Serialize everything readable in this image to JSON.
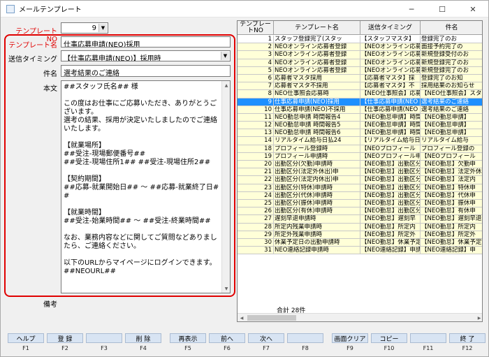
{
  "window": {
    "title": "メールテンプレート",
    "minimize": "─",
    "maximize": "☐",
    "close": "✕"
  },
  "form": {
    "template_no_label": "テンプレートNO",
    "template_no_value": "9",
    "template_name_label": "テンプレート名",
    "template_name_value": "仕事応募申請(NEO)採用",
    "timing_label": "送信タイミング",
    "timing_value": "【仕事応募申請(NEO)】採用時",
    "subject_label": "件名",
    "subject_value": "選考結果のご連絡",
    "body_label": "本文",
    "body_value": "##スタッフ氏名## 様\n\nこの度はお仕事にご応募いただき、ありがとうございます。\n選考の結果、採用が決定いたしましたのでご連絡いたします。\n\n【就業場所】\n##受注-現場郵便番号##\n##受注-現場住所1## ##受注-現場住所2##\n\n【契約期間】\n##応募-就業開始日## 〜 ##応募-就業終了日##\n\n【就業時間】\n##受注-始業時間## 〜 ##受注-終業時間##\n\nなお、業務内容などに関してご質問などありましたら、ご連絡ください。\n\n以下のURLからマイページにログインできます。\n##NEOURL##",
    "notes_label": "備考"
  },
  "grid": {
    "headers": [
      "テンプレートNO",
      "テンプレート名",
      "送信タイミング",
      "件名"
    ],
    "rows": [
      {
        "no": "1",
        "name": "スタッフ登録完了(スタッ",
        "timing": "【スタッフマスタ】",
        "subject": "登録完了のお",
        "style": "white"
      },
      {
        "no": "2",
        "name": "NEOオンライン応募者登録",
        "timing": "【NEOオンライン応募",
        "subject": "面接予約完了の",
        "style": "yellow"
      },
      {
        "no": "3",
        "name": "NEOオンライン応募者登録",
        "timing": "【NEOオンライン応募",
        "subject": "新規登録受付のお",
        "style": "yellow"
      },
      {
        "no": "4",
        "name": "NEOオンライン応募者登録",
        "timing": "【NEOオンライン応募",
        "subject": "新規登録完了のお",
        "style": "yellow"
      },
      {
        "no": "5",
        "name": "NEOオンライン応募者登録",
        "timing": "【NEOオンライン応募",
        "subject": "新規登録完了のお",
        "style": "yellow"
      },
      {
        "no": "6",
        "name": "応募者マスタ採用",
        "timing": "【応募者マスタ】採",
        "subject": "登録完了のお知",
        "style": "yellow"
      },
      {
        "no": "7",
        "name": "応募者マスタ不採用",
        "timing": "【応募者マスタ】不",
        "subject": "採用結果のお知らせ",
        "style": "yellow"
      },
      {
        "no": "8",
        "name": "NEO仕事照会応募時",
        "timing": "【NEO仕事照会】応募",
        "subject": "【NEO仕事照会】スタ",
        "style": "yellow"
      },
      {
        "no": "9",
        "name": "仕事応募申請(NEO)採用",
        "timing": "【仕事応募申請(NEO",
        "subject": "選考結果のご連絡",
        "style": "sel"
      },
      {
        "no": "10",
        "name": "仕事応募申請(NEO)不採用",
        "timing": "【仕事応募申請(NEO",
        "subject": "選考結果のご連絡",
        "style": "yellow"
      },
      {
        "no": "11",
        "name": "NEO勤怠申請 時間報告4",
        "timing": "【NEO勤怠申請】時間",
        "subject": "【NEO勤怠申請】",
        "style": "yellow"
      },
      {
        "no": "12",
        "name": "NEO勤怠申請 時間報告5",
        "timing": "【NEO勤怠申請】時間",
        "subject": "【NEO勤怠申請】",
        "style": "yellow"
      },
      {
        "no": "13",
        "name": "NEO勤怠申請 時間報告6",
        "timing": "【NEO勤怠申請】時間",
        "subject": "【NEO勤怠申請】",
        "style": "yellow"
      },
      {
        "no": "14",
        "name": "リアルタイム給与日払24",
        "timing": "【リアルタイム給与日払】",
        "subject": "リアルタイム給与",
        "style": "yellow"
      },
      {
        "no": "18",
        "name": "プロフィール登録時",
        "timing": "【NEOプロフィール",
        "subject": "プロフィール登録の",
        "style": "yellow"
      },
      {
        "no": "19",
        "name": "プロフィール申請時",
        "timing": "【NEOプロフィール申",
        "subject": "【NEOプロフィール",
        "style": "yellow"
      },
      {
        "no": "20",
        "name": "出勤区分(欠勤)申請時",
        "timing": "【NEO勤怠】出勤区分",
        "subject": "【NEO勤怠】欠勤申",
        "style": "yellow"
      },
      {
        "no": "21",
        "name": "出勤区分(法定外休出)申",
        "timing": "【NEO勤怠】出勤区分",
        "subject": "【NEO勤怠】法定外休",
        "style": "yellow"
      },
      {
        "no": "22",
        "name": "出勤区分(法定内休出)申",
        "timing": "【NEO勤怠】出勤区分",
        "subject": "【NEO勤怠】法定内",
        "style": "yellow"
      },
      {
        "no": "23",
        "name": "出勤区分(特休)申請時",
        "timing": "【NEO勤怠】出勤区分",
        "subject": "【NEO勤怠】特休申",
        "style": "yellow"
      },
      {
        "no": "24",
        "name": "出勤区分(代休)申請時",
        "timing": "【NEO勤怠】出勤区分",
        "subject": "【NEO勤怠】代休申",
        "style": "yellow"
      },
      {
        "no": "25",
        "name": "出勤区分(振休)申請時",
        "timing": "【NEO勤怠】出勤区分",
        "subject": "【NEO勤怠】振休申",
        "style": "yellow"
      },
      {
        "no": "26",
        "name": "出勤区分(有休)申請時",
        "timing": "【NEO勤怠】出勤区分",
        "subject": "【NEO勤怠】有休申",
        "style": "yellow"
      },
      {
        "no": "27",
        "name": "遅刻早退申請時",
        "timing": "【NEO勤怠】遅刻早",
        "subject": "【NEO勤怠】遅刻早退",
        "style": "yellow"
      },
      {
        "no": "28",
        "name": "所定内残業申請時",
        "timing": "【NEO勤怠】所定内",
        "subject": "【NEO勤怠】所定内",
        "style": "yellow"
      },
      {
        "no": "29",
        "name": "所定外残業申請時",
        "timing": "【NEO勤怠】所定外",
        "subject": "【NEO勤怠】所定外",
        "style": "yellow"
      },
      {
        "no": "30",
        "name": "休業予定日の出勤申請時",
        "timing": "【NEO勤怠】休業予定",
        "subject": "【NEO勤怠】休業予定",
        "style": "yellow"
      },
      {
        "no": "31",
        "name": "NEO連絡記録申請時",
        "timing": "【NEO連絡記録】申請",
        "subject": "【NEO連絡記録】申",
        "style": "yellow"
      }
    ],
    "total": "合計 28件"
  },
  "fkeys": [
    {
      "label": "ヘルプ",
      "key": "F1"
    },
    {
      "label": "登 録",
      "key": "F2"
    },
    {
      "label": "",
      "key": "F3"
    },
    {
      "label": "削 除",
      "key": "F4"
    },
    {
      "label": "再表示",
      "key": "F5"
    },
    {
      "label": "前へ",
      "key": "F6"
    },
    {
      "label": "次へ",
      "key": "F7"
    },
    {
      "label": "",
      "key": "F8"
    },
    {
      "label": "画面クリア",
      "key": "F9"
    },
    {
      "label": "コピー",
      "key": "F10"
    },
    {
      "label": "",
      "key": "F11"
    },
    {
      "label": "終 了",
      "key": "F12"
    }
  ]
}
